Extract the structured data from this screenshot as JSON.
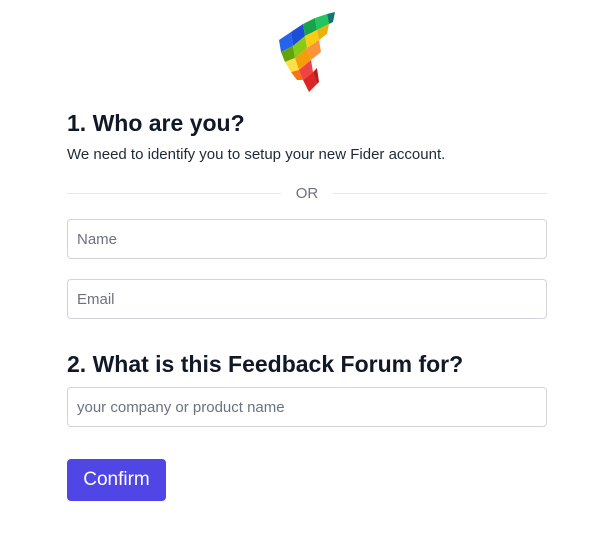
{
  "logo": {
    "icon": "fider-logo-icon"
  },
  "step1": {
    "title": "1. Who are you?",
    "subtitle": "We need to identify you to setup your new Fider account.",
    "divider_text": "OR",
    "name_placeholder": "Name",
    "email_placeholder": "Email"
  },
  "step2": {
    "title": "2. What is this Feedback Forum for?",
    "company_placeholder": "your company or product name"
  },
  "confirm_label": "Confirm",
  "colors": {
    "primary": "#4f46e5",
    "border": "#d1d5db",
    "divider": "#e5e7eb"
  }
}
